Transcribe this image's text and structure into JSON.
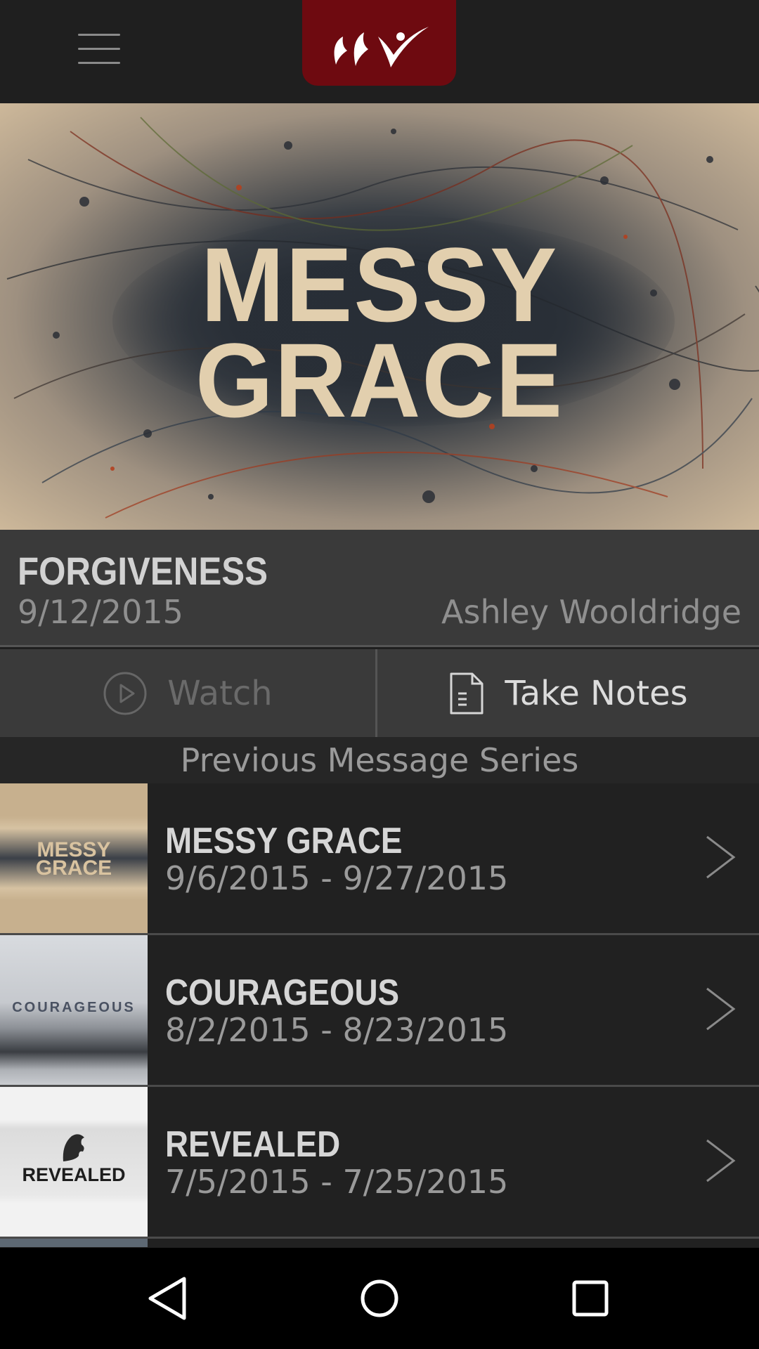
{
  "header": {
    "menu_icon": "hamburger-menu-icon",
    "logo_icon": "ccv-logo-icon",
    "brand_color": "#6e0a10"
  },
  "hero": {
    "artwork_text": "MESSY\nGRACE"
  },
  "current_message": {
    "title": "FORGIVENESS",
    "date": "9/12/2015",
    "speaker": "Ashley Wooldridge"
  },
  "actions": {
    "watch_label": "Watch",
    "watch_icon": "play-circle-icon",
    "notes_label": "Take Notes",
    "notes_icon": "document-icon"
  },
  "previous_series": {
    "heading": "Previous Message Series",
    "items": [
      {
        "title": "MESSY GRACE",
        "dates": "9/6/2015 - 9/27/2015",
        "thumb_text": "MESSY\nGRACE"
      },
      {
        "title": "COURAGEOUS",
        "dates": "8/2/2015 - 8/23/2015",
        "thumb_text": "COURAGEOUS"
      },
      {
        "title": "REVEALED",
        "dates": "7/5/2015 - 7/25/2015",
        "thumb_text": "REVEALED"
      }
    ]
  },
  "navbar": {
    "back_icon": "back-triangle-icon",
    "home_icon": "home-circle-icon",
    "recents_icon": "recents-square-icon"
  }
}
